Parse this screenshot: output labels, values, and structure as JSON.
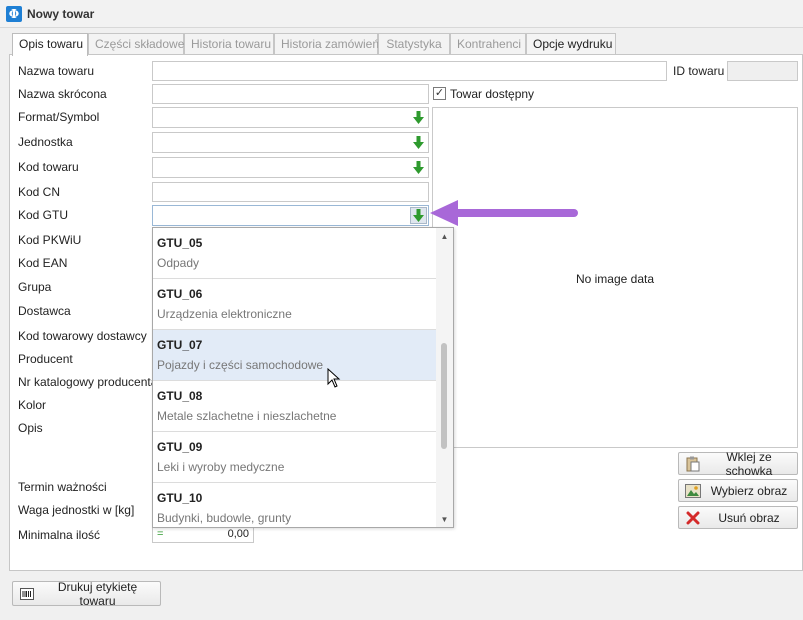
{
  "window": {
    "title": "Nowy towar",
    "app_icon_glyph": "Φ"
  },
  "tabs": [
    {
      "label": "Opis towaru",
      "state": "active"
    },
    {
      "label": "Części składowe",
      "state": "disabled"
    },
    {
      "label": "Historia towaru",
      "state": "disabled"
    },
    {
      "label": "Historia zamówień",
      "state": "disabled"
    },
    {
      "label": "Statystyka",
      "state": "disabled"
    },
    {
      "label": "Kontrahenci",
      "state": "disabled"
    },
    {
      "label": "Opcje wydruku",
      "state": "normal"
    }
  ],
  "labels": {
    "nazwa_towaru": "Nazwa towaru",
    "id_towaru": "ID towaru",
    "nazwa_skrocona": "Nazwa skrócona",
    "towar_dostepny": "Towar dostępny",
    "format_symbol": "Format/Symbol",
    "jednostka": "Jednostka",
    "kod_towaru": "Kod towaru",
    "kod_cn": "Kod CN",
    "kod_gtu": "Kod GTU",
    "kod_pkwiu": "Kod PKWiU",
    "kod_ean": "Kod EAN",
    "grupa": "Grupa",
    "dostawca": "Dostawca",
    "kod_towarowy_dostawcy": "Kod towarowy dostawcy",
    "producent": "Producent",
    "nr_katalogowy": "Nr katalogowy producenta",
    "kolor": "Kolor",
    "opis": "Opis",
    "termin_waznosci": "Termin ważności",
    "waga": "Waga jednostki w [kg]",
    "minimalna_ilosc": "Minimalna ilość"
  },
  "fields": {
    "minimalna_ilosc_prefix": "=",
    "minimalna_ilosc_value": "0,00",
    "towar_dostepny_checked": "✓"
  },
  "image": {
    "placeholder": "No image data"
  },
  "buttons": {
    "wklej": "Wklej ze schowka",
    "wybierz": "Wybierz obraz",
    "usun": "Usuń obraz",
    "drukuj": "Drukuj etykietę towaru"
  },
  "gtu_dropdown": {
    "items": [
      {
        "code": "GTU_05",
        "desc": "Odpady"
      },
      {
        "code": "GTU_06",
        "desc": "Urządzenia elektroniczne"
      },
      {
        "code": "GTU_07",
        "desc": "Pojazdy i części samochodowe"
      },
      {
        "code": "GTU_08",
        "desc": "Metale szlachetne i nieszlachetne"
      },
      {
        "code": "GTU_09",
        "desc": "Leki i wyroby medyczne"
      },
      {
        "code": "GTU_10",
        "desc": "Budynki, budowle, grunty"
      }
    ],
    "highlighted_index": 2
  },
  "colors": {
    "accent_green": "#2e9a2e",
    "annotation_arrow": "#a868d8",
    "highlight_row": "#e2ebf7",
    "app_icon": "#1e7fd4"
  },
  "icons": {
    "dropdown": "green-down-arrow-icon",
    "annotation": "purple-arrow-icon",
    "paste": "clipboard-icon",
    "choose_image": "image-icon",
    "delete": "red-x-icon",
    "print": "barcode-icon"
  }
}
